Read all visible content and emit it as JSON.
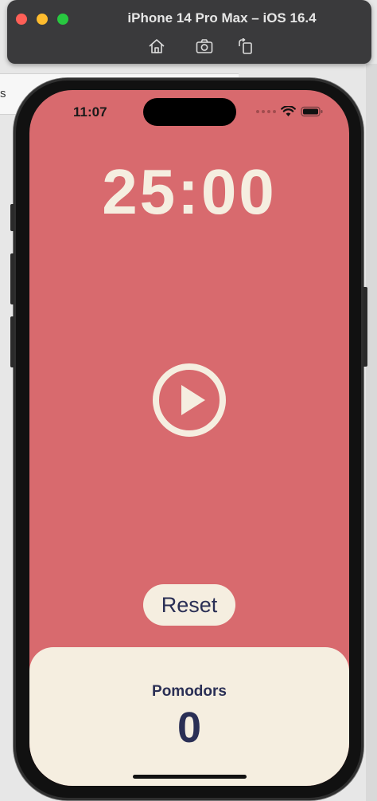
{
  "window": {
    "title": "iPhone 14 Pro Max – iOS 16.4",
    "behind_text": "s"
  },
  "toolbar": {
    "icons": [
      "home-icon",
      "screenshot-icon",
      "rotate-icon"
    ]
  },
  "status_bar": {
    "time": "11:07",
    "icons": [
      "cellular-dots-icon",
      "wifi-icon",
      "battery-icon"
    ]
  },
  "app": {
    "timer": "25:00",
    "play_icon": "play-circle-icon",
    "reset_label": "Reset",
    "pomodoros_label": "Pomodors",
    "pomodoros_count": "0"
  },
  "colors": {
    "background": "#d86a6e",
    "cream": "#f5eee0",
    "navy": "#2a2f55"
  }
}
